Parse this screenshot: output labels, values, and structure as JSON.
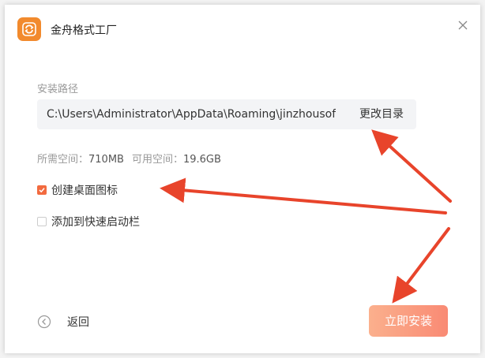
{
  "window": {
    "app_title": "金舟格式工厂",
    "app_icon": "app-logo-icon",
    "close_icon": "close-icon"
  },
  "install": {
    "path_label": "安装路径",
    "path_value": "C:\\Users\\Administrator\\AppData\\Roaming\\jinzhousoft",
    "change_dir_label": "更改目录",
    "required_label": "所需空间：",
    "required_value": "710MB",
    "available_label": "可用空间：",
    "available_value": "19.6GB"
  },
  "options": {
    "desktop_icon": {
      "label": "创建桌面图标",
      "checked": true
    },
    "quick_launch": {
      "label": "添加到快速启动栏",
      "checked": false
    }
  },
  "footer": {
    "back_label": "返回",
    "install_label": "立即安装"
  },
  "colors": {
    "accent": "#f26a3f",
    "arrow": "#e8442b",
    "install_gradient_start": "#fbb08d",
    "install_gradient_end": "#f98a74"
  }
}
